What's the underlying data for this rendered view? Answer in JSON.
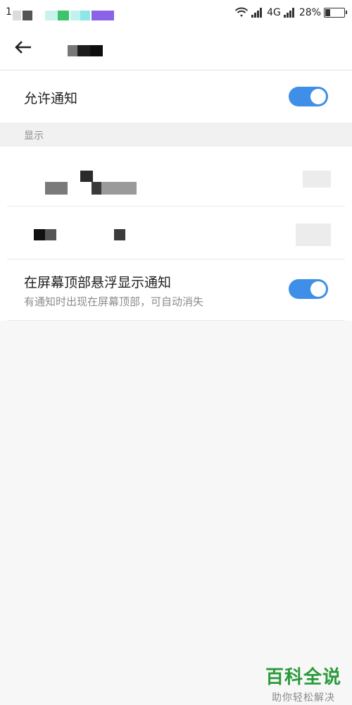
{
  "status_bar": {
    "time": "1",
    "network": "4G",
    "battery_percent": "28%",
    "battery_level": 0.28
  },
  "header": {
    "back_icon": "back-arrow-icon"
  },
  "settings": {
    "allow_notifications": {
      "label": "允许通知",
      "enabled": true
    },
    "section_display": "显示",
    "floating": {
      "label": "在屏幕顶部悬浮显示通知",
      "sub": "有通知时出现在屏幕顶部，可自动消失",
      "enabled": true
    }
  },
  "watermark": {
    "title": "百科全说",
    "subtitle": "助你轻松解决"
  },
  "colors": {
    "accent": "#3f8ee8",
    "watermark_green": "#2a9a3b"
  }
}
